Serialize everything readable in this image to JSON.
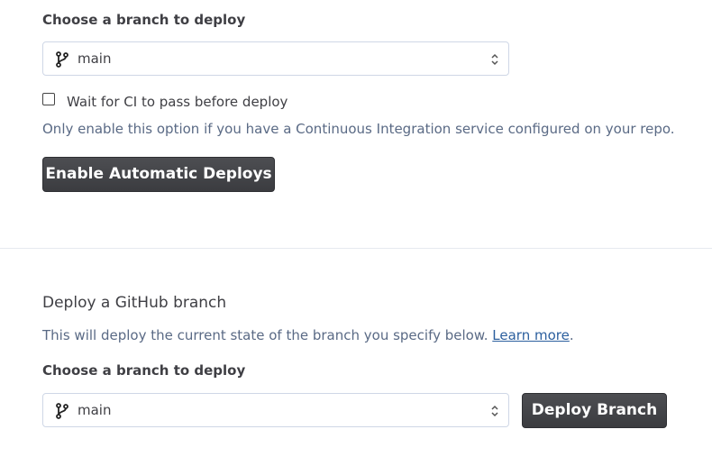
{
  "auto_deploy": {
    "branch_label": "Choose a branch to deploy",
    "branch_value": "main",
    "ci_checkbox_label": "Wait for CI to pass before deploy",
    "ci_checked": false,
    "ci_help": "Only enable this option if you have a Continuous Integration service configured on your repo.",
    "enable_button": "Enable Automatic Deploys"
  },
  "manual_deploy": {
    "title": "Deploy a GitHub branch",
    "description": "This will deploy the current state of the branch you specify below.",
    "learn_more": "Learn more",
    "description_end": ".",
    "branch_label": "Choose a branch to deploy",
    "branch_value": "main",
    "deploy_button": "Deploy Branch"
  },
  "icons": {
    "branch": "git-branch-icon",
    "select_arrows": "chevron-up-down-icon"
  },
  "colors": {
    "button_bg": "#45464a",
    "muted_text": "#5a6a85",
    "link": "#2c5f9e",
    "border": "#cfd7e6"
  }
}
